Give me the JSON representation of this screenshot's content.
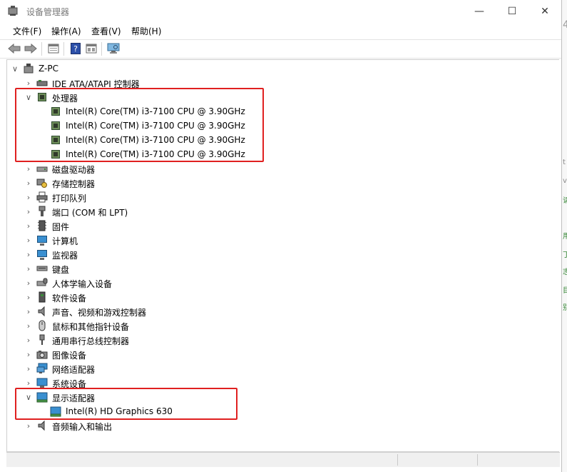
{
  "window": {
    "title": "设备管理器",
    "controls": {
      "minimize": "—",
      "maximize": "☐",
      "close": "✕"
    }
  },
  "menu": [
    "文件(F)",
    "操作(A)",
    "查看(V)",
    "帮助(H)"
  ],
  "toolbar": {
    "buttons": [
      "back-icon",
      "forward-icon",
      "properties-icon",
      "help-icon",
      "details-icon",
      "scan-monitor-icon"
    ]
  },
  "tree": {
    "root": {
      "label": "Z-PC",
      "expanded": true
    },
    "categories": [
      {
        "label": "IDE ATA/ATAPI 控制器",
        "expanded": false,
        "icon": "ide-controller-icon"
      },
      {
        "label": "处理器",
        "expanded": true,
        "icon": "processor-icon",
        "children": [
          "Intel(R) Core(TM) i3-7100 CPU @ 3.90GHz",
          "Intel(R) Core(TM) i3-7100 CPU @ 3.90GHz",
          "Intel(R) Core(TM) i3-7100 CPU @ 3.90GHz",
          "Intel(R) Core(TM) i3-7100 CPU @ 3.90GHz"
        ]
      },
      {
        "label": "磁盘驱动器",
        "expanded": false,
        "icon": "disk-drive-icon"
      },
      {
        "label": "存储控制器",
        "expanded": false,
        "icon": "storage-controller-icon"
      },
      {
        "label": "打印队列",
        "expanded": false,
        "icon": "printer-icon"
      },
      {
        "label": "端口 (COM 和 LPT)",
        "expanded": false,
        "icon": "port-icon"
      },
      {
        "label": "固件",
        "expanded": false,
        "icon": "firmware-icon"
      },
      {
        "label": "计算机",
        "expanded": false,
        "icon": "computer-icon"
      },
      {
        "label": "监视器",
        "expanded": false,
        "icon": "monitor-icon"
      },
      {
        "label": "键盘",
        "expanded": false,
        "icon": "keyboard-icon"
      },
      {
        "label": "人体学输入设备",
        "expanded": false,
        "icon": "hid-icon"
      },
      {
        "label": "软件设备",
        "expanded": false,
        "icon": "software-device-icon"
      },
      {
        "label": "声音、视频和游戏控制器",
        "expanded": false,
        "icon": "speaker-icon"
      },
      {
        "label": "鼠标和其他指针设备",
        "expanded": false,
        "icon": "mouse-icon"
      },
      {
        "label": "通用串行总线控制器",
        "expanded": false,
        "icon": "usb-icon"
      },
      {
        "label": "图像设备",
        "expanded": false,
        "icon": "camera-icon"
      },
      {
        "label": "网络适配器",
        "expanded": false,
        "icon": "network-adapter-icon"
      },
      {
        "label": "系统设备",
        "expanded": false,
        "icon": "system-device-icon"
      },
      {
        "label": "显示适配器",
        "expanded": true,
        "icon": "display-adapter-icon",
        "children": [
          "Intel(R) HD Graphics 630"
        ]
      },
      {
        "label": "音频输入和输出",
        "expanded": false,
        "icon": "audio-io-icon"
      }
    ]
  },
  "highlight_color": "#e02020",
  "background_window": {
    "fragments": [
      "4",
      "t",
      "vs",
      "请",
      "用",
      "丁",
      "志",
      "目",
      "别"
    ]
  }
}
